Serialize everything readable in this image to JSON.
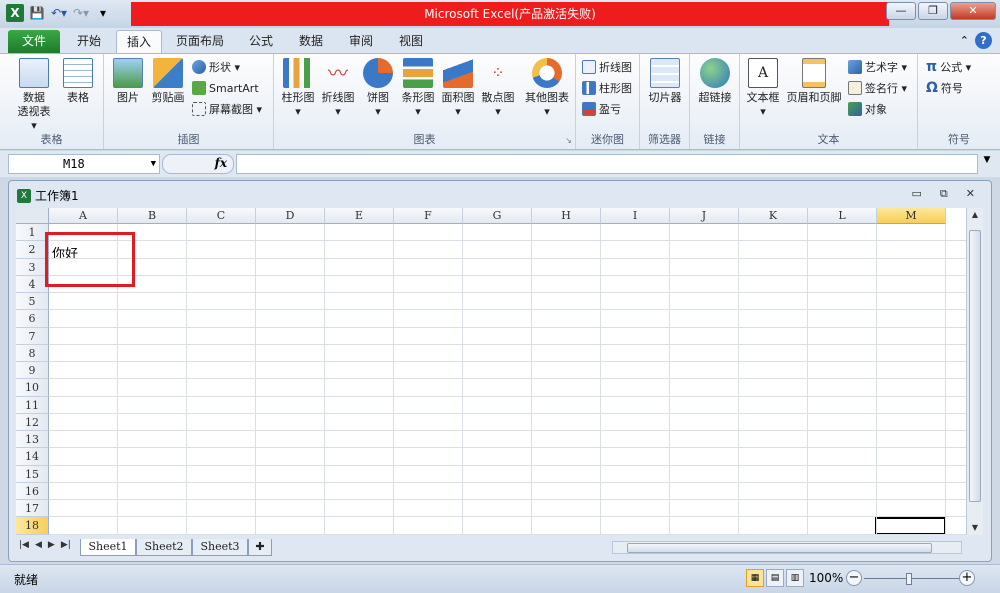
{
  "titlebar": {
    "title": "Microsoft Excel(产品激活失败)",
    "app_icon": "excel-icon",
    "minimize": "—",
    "restore": "❐",
    "close": "✕"
  },
  "tabs": [
    "文件",
    "开始",
    "插入",
    "页面布局",
    "公式",
    "数据",
    "审阅",
    "视图"
  ],
  "ribbon": {
    "groups": {
      "table": "表格",
      "illustrations": "插图",
      "charts": "图表",
      "sparklines": "迷你图",
      "filter": "筛选器",
      "links": "链接",
      "text": "文本",
      "symbols": "符号"
    },
    "buttons": {
      "pivot_line1": "数据",
      "pivot_line2": "透视表 ▾",
      "table": "表格",
      "picture": "图片",
      "clipart": "剪贴画",
      "shapes": "形状 ▾",
      "smartart": "SmartArt",
      "screenshot": "屏幕截图 ▾",
      "column": "柱形图",
      "line": "折线图",
      "pie": "饼图",
      "bar": "条形图",
      "area": "面积图",
      "scatter": "散点图",
      "other": "其他图表",
      "spark_line": "折线图",
      "spark_column": "柱形图",
      "spark_winloss": "盈亏",
      "slicer": "切片器",
      "hyperlink": "超链接",
      "textbox": "文本框",
      "header_footer": "页眉和页脚",
      "wordart": "艺术字 ▾",
      "signature": "签名行 ▾",
      "object": "对象",
      "equation": "公式 ▾",
      "symbol": "符号"
    }
  },
  "formula_bar": {
    "name_box": "M18",
    "fx": "fx",
    "value": ""
  },
  "workbook": {
    "title": "工作簿1",
    "columns": [
      "A",
      "B",
      "C",
      "D",
      "E",
      "F",
      "G",
      "H",
      "I",
      "J",
      "K",
      "L",
      "M"
    ],
    "rows": [
      "1",
      "2",
      "3",
      "4",
      "5",
      "6",
      "7",
      "8",
      "9",
      "10",
      "11",
      "12",
      "13",
      "14",
      "15",
      "16",
      "17",
      "18"
    ],
    "cell_A2": "你好",
    "active_cell": "M18"
  },
  "sheets": [
    "Sheet1",
    "Sheet2",
    "Sheet3"
  ],
  "status": {
    "ready": "就绪",
    "zoom": "100%"
  },
  "colors": {
    "title_bar_red": "#ee1c1c",
    "file_tab_green": "#1f7a2b",
    "annotation_red": "#e01b24"
  }
}
